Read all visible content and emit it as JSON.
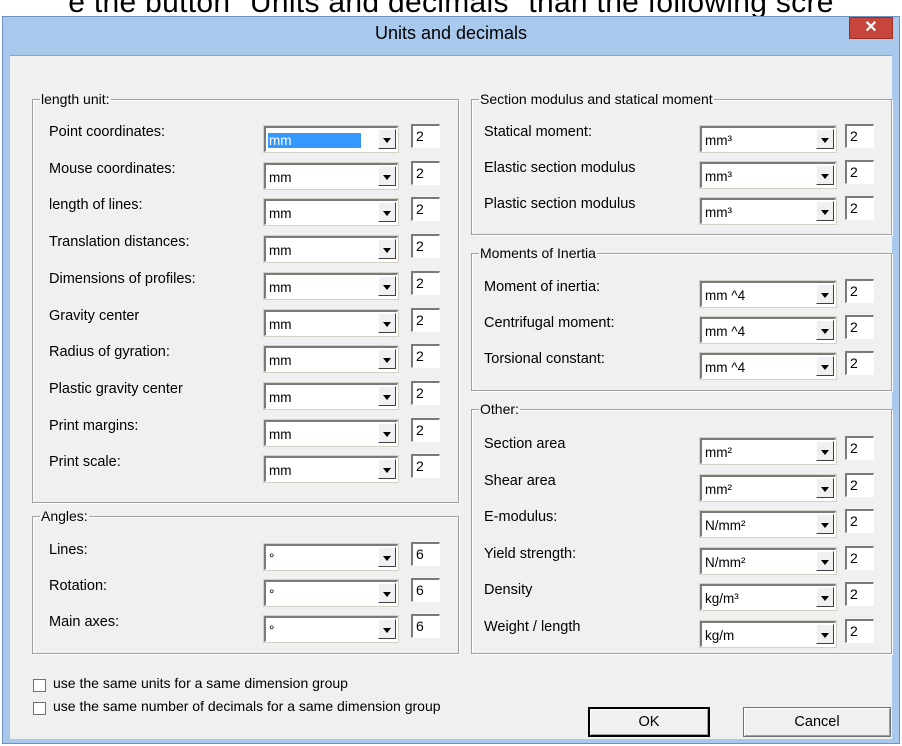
{
  "background_caption": "e the button \"Units and decimals\" than the following scre",
  "window": {
    "title": "Units and decimals",
    "close_label": "✕"
  },
  "length_unit": {
    "legend": "length unit:",
    "rows": [
      {
        "label": "Point coordinates:",
        "unit": "mm",
        "decimals": "2"
      },
      {
        "label": "Mouse coordinates:",
        "unit": "mm",
        "decimals": "2"
      },
      {
        "label": "length of lines:",
        "unit": "mm",
        "decimals": "2"
      },
      {
        "label": "Translation distances:",
        "unit": "mm",
        "decimals": "2"
      },
      {
        "label": "Dimensions of profiles:",
        "unit": "mm",
        "decimals": "2"
      },
      {
        "label": "Gravity center",
        "unit": "mm",
        "decimals": "2"
      },
      {
        "label": "Radius of gyration:",
        "unit": "mm",
        "decimals": "2"
      },
      {
        "label": "Plastic gravity center",
        "unit": "mm",
        "decimals": "2"
      },
      {
        "label": "Print margins:",
        "unit": "mm",
        "decimals": "2"
      },
      {
        "label": "Print scale:",
        "unit": "mm",
        "decimals": "2"
      }
    ]
  },
  "angles": {
    "legend": "Angles:",
    "rows": [
      {
        "label": "Lines:",
        "unit": "°",
        "decimals": "6"
      },
      {
        "label": "Rotation:",
        "unit": "°",
        "decimals": "6"
      },
      {
        "label": "Main axes:",
        "unit": "°",
        "decimals": "6"
      }
    ]
  },
  "section_modulus": {
    "legend": "Section modulus and statical moment",
    "rows": [
      {
        "label": "Statical moment:",
        "unit": "mm³",
        "decimals": "2"
      },
      {
        "label": "Elastic section modulus",
        "unit": "mm³",
        "decimals": "2"
      },
      {
        "label": "Plastic section modulus",
        "unit": "mm³",
        "decimals": "2"
      }
    ]
  },
  "moments_inertia": {
    "legend": "Moments of Inertia",
    "rows": [
      {
        "label": "Moment of inertia:",
        "unit": "mm ^4",
        "decimals": "2"
      },
      {
        "label": "Centrifugal moment:",
        "unit": "mm ^4",
        "decimals": "2"
      },
      {
        "label": "Torsional constant:",
        "unit": "mm ^4",
        "decimals": "2"
      }
    ]
  },
  "other": {
    "legend": "Other:",
    "rows": [
      {
        "label": "Section area",
        "unit": "mm²",
        "decimals": "2"
      },
      {
        "label": "Shear area",
        "unit": "mm²",
        "decimals": "2"
      },
      {
        "label": "E-modulus:",
        "unit": "N/mm²",
        "decimals": "2"
      },
      {
        "label": "Yield strength:",
        "unit": "N/mm²",
        "decimals": "2"
      },
      {
        "label": "Density",
        "unit": "kg/m³",
        "decimals": "2"
      },
      {
        "label": "Weight / length",
        "unit": "kg/m",
        "decimals": "2"
      }
    ]
  },
  "options": {
    "same_units": "use the same units for a same dimension group",
    "same_decimals": "use the same number of decimals for a same dimension group"
  },
  "buttons": {
    "ok": "OK",
    "cancel": "Cancel"
  }
}
